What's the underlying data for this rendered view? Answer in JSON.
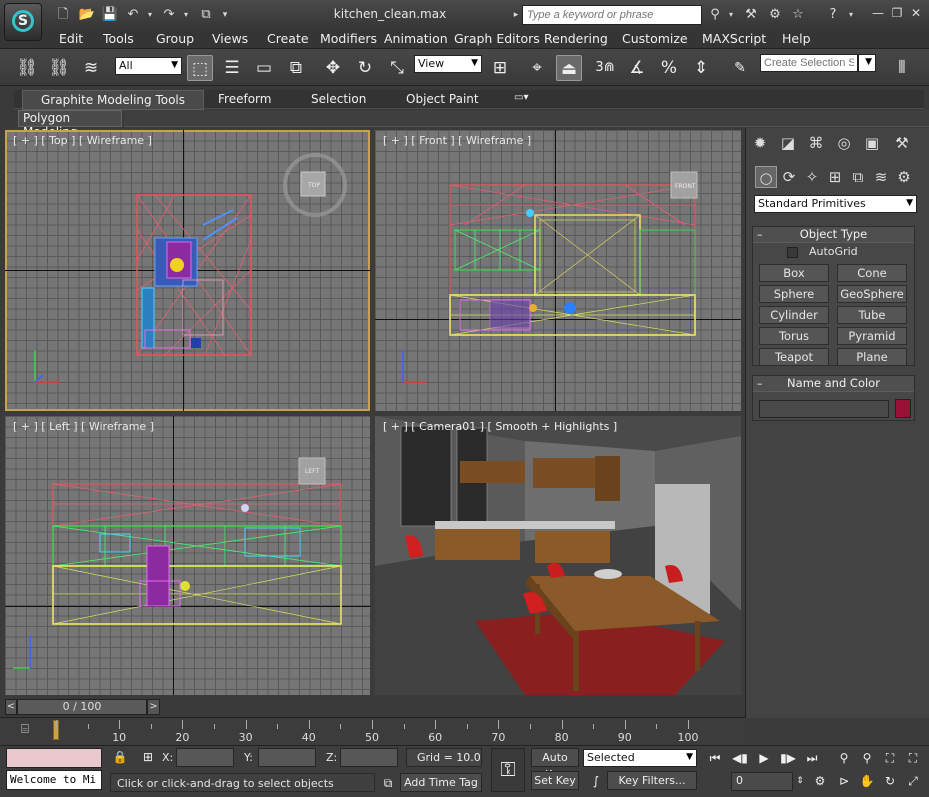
{
  "app": {
    "logo_letter": "S",
    "title": "kitchen_clean.max",
    "search_placeholder": "Type a keyword or phrase"
  },
  "menu": [
    "Edit",
    "Tools",
    "Group",
    "Views",
    "Create",
    "Modifiers",
    "Animation",
    "Graph Editors",
    "Rendering",
    "Customize",
    "MAXScript",
    "Help"
  ],
  "toolbar": {
    "selection_filter": "All",
    "reference_coord": "View",
    "snap_number": "3",
    "named_selection_placeholder": "Create Selection Se"
  },
  "ribbon": {
    "tabs": [
      "Graphite Modeling Tools",
      "Freeform",
      "Selection",
      "Object Paint"
    ],
    "active_tab": "Graphite Modeling Tools",
    "panel_label": "Polygon Modeling"
  },
  "viewports": {
    "top": {
      "label": "[ + ] [ Top ] [ Wireframe ]",
      "cube_label": "TOP"
    },
    "front": {
      "label": "[ + ] [ Front ] [ Wireframe ]",
      "cube_label": "FRONT"
    },
    "left": {
      "label": "[ + ] [ Left ] [ Wireframe ]",
      "cube_label": "LEFT"
    },
    "camera": {
      "label": "[ + ] [ Camera01 ] [ Smooth + Highlights ]"
    }
  },
  "command_panel": {
    "category_dropdown": "Standard Primitives",
    "object_type": {
      "title": "Object Type",
      "autogrid_label": "AutoGrid",
      "buttons": [
        "Box",
        "Cone",
        "Sphere",
        "GeoSphere",
        "Cylinder",
        "Tube",
        "Torus",
        "Pyramid",
        "Teapot",
        "Plane"
      ]
    },
    "name_color": {
      "title": "Name and Color",
      "name_value": "",
      "color": "#9b1035"
    }
  },
  "timeline": {
    "slider_text": "0 / 100",
    "prev_label": "<",
    "next_label": ">",
    "ticks": [
      "0",
      "10",
      "20",
      "30",
      "40",
      "50",
      "60",
      "70",
      "80",
      "90",
      "100"
    ]
  },
  "status": {
    "maxscript_output": "Welcome to Mi",
    "prompt": "Click or click-and-drag to select objects",
    "x_label": "X:",
    "y_label": "Y:",
    "z_label": "Z:",
    "grid": "Grid = 10.0",
    "add_time_tag": "Add Time Tag",
    "auto_key": "Auto Key",
    "set_key": "Set Key",
    "key_mode": "Selected",
    "key_filters": "Key Filters...",
    "current_frame": "0"
  },
  "colors": {
    "accent_active_viewport": "#c8a24a",
    "viewport_bg": "#767676",
    "logo_ring": "#36c3c9"
  }
}
